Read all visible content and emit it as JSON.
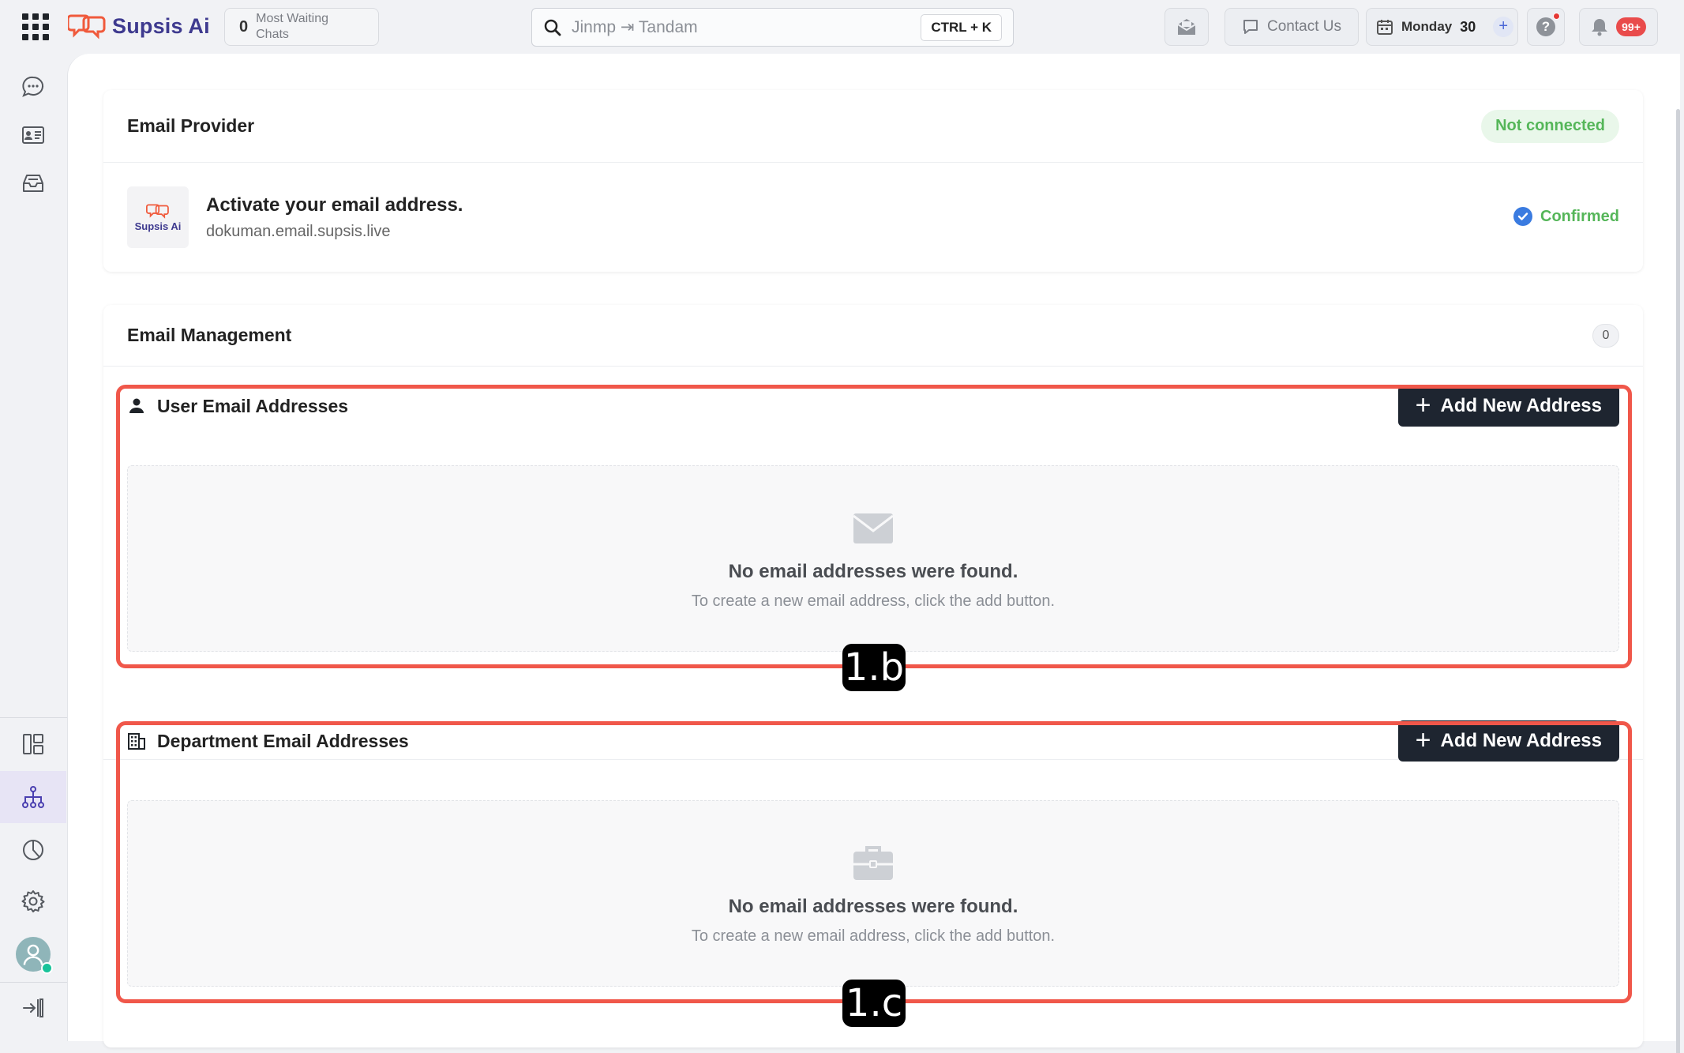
{
  "app": {
    "name": "Supsis Ai"
  },
  "topbar": {
    "waiting_count": "0",
    "waiting_label": "Most Waiting Chats",
    "search_placeholder": "Jinmp ⇥ Tandam",
    "search_shortcut": "CTRL + K",
    "contact_label": "Contact Us",
    "date_day": "Monday",
    "date_num": "30",
    "notifications_badge": "99+"
  },
  "provider": {
    "title": "Email Provider",
    "status": "Not connected",
    "logo_text": "Supsis Ai",
    "activate_title": "Activate your email address.",
    "domain": "dokuman.email.supsis.live",
    "confirmed_label": "Confirmed"
  },
  "management": {
    "title": "Email Management",
    "count": "0",
    "user_section": {
      "title": "User Email Addresses",
      "add_label": "Add New Address",
      "empty_title": "No email addresses were found.",
      "empty_sub": "To create a new email address, click the add button."
    },
    "dept_section": {
      "title": "Department Email Addresses",
      "add_label": "Add New Address",
      "empty_title": "No email addresses were found.",
      "empty_sub": "To create a new email address, click the add button."
    }
  },
  "annotations": {
    "a1": "1.b",
    "a2": "1.c"
  },
  "colors": {
    "accent": "#3e3a8f",
    "status_green": "#55b659",
    "annotation_red": "#f0574a",
    "button_dark": "#1e2530"
  }
}
